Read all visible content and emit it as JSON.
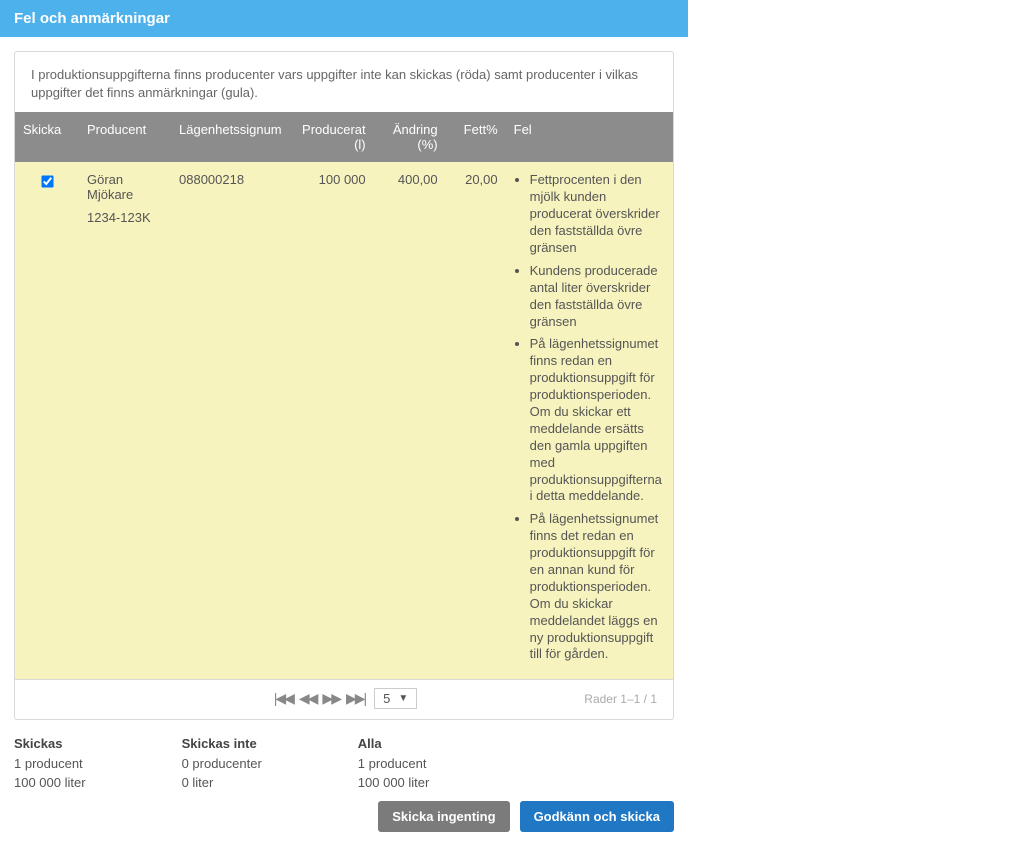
{
  "header": {
    "title": "Fel och anmärkningar"
  },
  "intro": "I produktionsuppgifterna finns producenter vars uppgifter inte kan skickas (röda) samt producenter i vilkas uppgifter det finns anmärkningar (gula).",
  "columns": {
    "send": "Skicka",
    "producer": "Producent",
    "property": "Lägenhetssignum",
    "produced": "Producerat (l)",
    "change": "Ändring (%)",
    "fat": "Fett%",
    "errors": "Fel"
  },
  "row": {
    "checked": true,
    "producer_name": "Göran Mjökare",
    "producer_id": "1234-123K",
    "property": "088000218",
    "produced": "100 000",
    "change": "400,00",
    "fat": "20,00",
    "errors": [
      "Fettprocenten i den mjölk kunden producerat överskrider den fastställda övre gränsen",
      "Kundens producerade antal liter överskrider den fastställda övre gränsen",
      "På lägenhetssignumet finns redan en produktionsuppgift för produktionsperioden. Om du skickar ett meddelande ersätts den gamla uppgiften med produktionsuppgifterna i detta meddelande.",
      "På lägenhetssignumet finns det redan en produktionsuppgift för en annan kund för produktionsperioden. Om du skickar meddelandet läggs en ny produktionsuppgift till för gården."
    ]
  },
  "pager": {
    "page_size": "5",
    "rows_label": "Rader 1–1 / 1"
  },
  "summary": {
    "send": {
      "title": "Skickas",
      "line1": "1 producent",
      "line2": "100 000 liter"
    },
    "nosend": {
      "title": "Skickas inte",
      "line1": "0 producenter",
      "line2": "0 liter"
    },
    "all": {
      "title": "Alla",
      "line1": "1 producent",
      "line2": "100 000 liter"
    }
  },
  "buttons": {
    "none": "Skicka ingenting",
    "approve": "Godkänn och skicka"
  }
}
